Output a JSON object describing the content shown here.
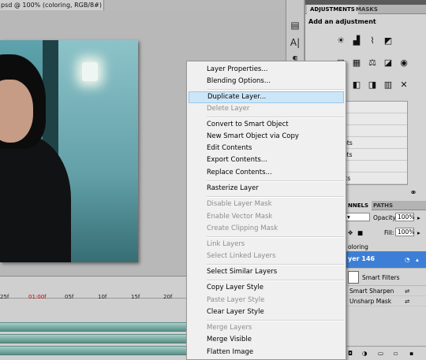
{
  "document": {
    "tab_title": "psd @ 100% (coloring, RGB/8#) *",
    "close_glyph": "✕"
  },
  "timeline": {
    "ticks": [
      "25f",
      "01:00f",
      "05f",
      "10f",
      "15f",
      "20f"
    ]
  },
  "adjustments_panel": {
    "tabs": [
      "ADJUSTMENTS",
      "MASKS"
    ],
    "heading": "Add an adjustment",
    "presets": [
      "resets",
      "resets",
      "Presets",
      "ration Presets",
      "White Presets",
      "ixer Presets",
      "Color Presets"
    ]
  },
  "layers_panel": {
    "tabs": [
      "NNELS",
      "PATHS"
    ],
    "opacity_label": "Opacity:",
    "opacity_value": "100%",
    "fill_label": "Fill:",
    "fill_value": "100%",
    "group_name": "oloring",
    "layer_name": "yer 146",
    "smart_filters_label": "Smart Filters",
    "filters": [
      "Smart Sharpen",
      "Unsharp Mask"
    ]
  },
  "context_menu": {
    "items": [
      {
        "label": "Layer Properties...",
        "state": "enabled"
      },
      {
        "label": "Blending Options...",
        "state": "enabled"
      },
      {
        "label": "Duplicate Layer...",
        "state": "highlighted"
      },
      {
        "label": "Delete Layer",
        "state": "disabled"
      },
      {
        "label": "Convert to Smart Object",
        "state": "enabled"
      },
      {
        "label": "New Smart Object via Copy",
        "state": "enabled"
      },
      {
        "label": "Edit Contents",
        "state": "enabled"
      },
      {
        "label": "Export Contents...",
        "state": "enabled"
      },
      {
        "label": "Replace Contents...",
        "state": "enabled"
      },
      {
        "label": "Rasterize Layer",
        "state": "enabled"
      },
      {
        "label": "Disable Layer Mask",
        "state": "disabled"
      },
      {
        "label": "Enable Vector Mask",
        "state": "disabled"
      },
      {
        "label": "Create Clipping Mask",
        "state": "disabled"
      },
      {
        "label": "Link Layers",
        "state": "disabled"
      },
      {
        "label": "Select Linked Layers",
        "state": "disabled"
      },
      {
        "label": "Select Similar Layers",
        "state": "enabled"
      },
      {
        "label": "Copy Layer Style",
        "state": "enabled"
      },
      {
        "label": "Paste Layer Style",
        "state": "disabled"
      },
      {
        "label": "Clear Layer Style",
        "state": "enabled"
      },
      {
        "label": "Merge Layers",
        "state": "disabled"
      },
      {
        "label": "Merge Visible",
        "state": "enabled"
      },
      {
        "label": "Flatten Image",
        "state": "enabled"
      }
    ]
  }
}
